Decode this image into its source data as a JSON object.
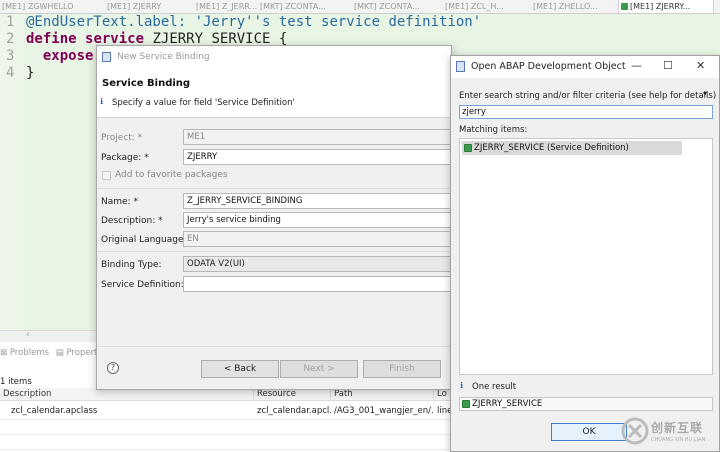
{
  "tabs": [
    {
      "label": "[ME1] ZGWHELLO",
      "active": false
    },
    {
      "label": "[ME1] ZJERRY",
      "active": false
    },
    {
      "label": "[ME1] Z_JERR...",
      "active": false
    },
    {
      "label": "[MKT] ZCONTA...",
      "active": false
    },
    {
      "label": "[MKT] ZCONTA...",
      "active": false
    },
    {
      "label": "[ME1] ZCL_H...",
      "active": false
    },
    {
      "label": "[ME1] ZHELLO...",
      "active": false
    },
    {
      "label": "[ME1] ZJERRY...",
      "active": true
    }
  ],
  "editor": {
    "line_numbers": [
      "1",
      "2",
      "3",
      "4"
    ],
    "line1_annotation": "@EndUserText.label: ",
    "line1_string": "'Jerry''s test service definition'",
    "line2_kw1": "define",
    "line2_kw2": "service",
    "line2_name": "ZJERRY_SERVICE {",
    "line3_kw": "expose",
    "line4": "}"
  },
  "bottom_view": {
    "tab_problems": "Problems",
    "tab_properties": "Properti",
    "items_count": "1 items",
    "columns": [
      "Description",
      "Resource",
      "Path",
      "Lo"
    ],
    "rows": [
      {
        "description": "zcl_calendar.apclass",
        "resource": "zcl_calendar.apcl...",
        "path": "/AG3_001_wangjer_en/...",
        "location": "line"
      }
    ]
  },
  "new_binding_dialog": {
    "title": "New Service Binding",
    "header_title": "Service Binding",
    "header_msg": "Specify a value for field 'Service Definition'",
    "fields": {
      "project_label": "Project: *",
      "project_value": "ME1",
      "package_label": "Package: *",
      "package_value": "ZJERRY",
      "favorite_label": "Add to favorite packages",
      "name_label": "Name: *",
      "name_value": "Z_JERRY_SERVICE_BINDING",
      "description_label": "Description: *",
      "description_value": "Jerry's service binding",
      "orig_lang_label": "Original Language:",
      "orig_lang_value": "EN",
      "binding_type_label": "Binding Type:",
      "binding_type_value": "ODATA V2(UI)",
      "service_def_label": "Service Definition: *",
      "service_def_value": ""
    },
    "buttons": {
      "help": "?",
      "back": "< Back",
      "next": "Next >",
      "finish": "Finish"
    }
  },
  "open_object_dialog": {
    "title": "Open ABAP Development Object",
    "search_label": "Enter search string and/or filter criteria (see help for details)",
    "search_value": "zjerry",
    "matching_label": "Matching items:",
    "matching_items": [
      "ZJERRY_SERVICE (Service Definition)"
    ],
    "result_count": "One result",
    "result_item": "ZJERRY_SERVICE",
    "ok_button": "OK"
  },
  "watermark": {
    "text": "创新互联",
    "sub": "CHUANG XIN HU LIAN"
  },
  "colors": {
    "editor_bg": "#e8f4e4",
    "keyword": "#7f0055",
    "string": "#2a6aa0",
    "object_icon": "#3c9b49"
  }
}
